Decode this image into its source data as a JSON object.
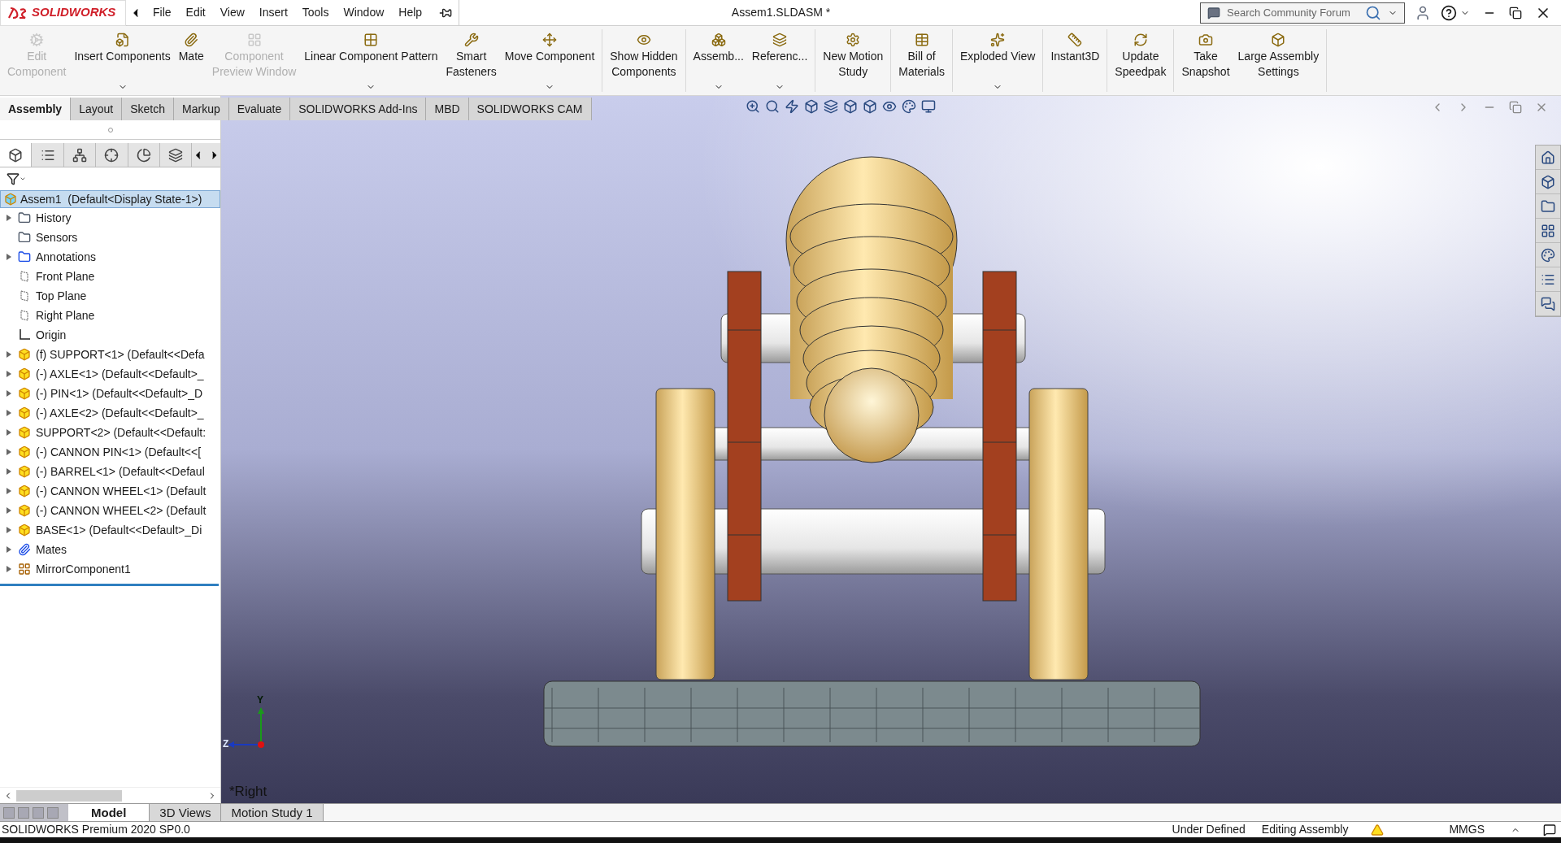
{
  "logo": {
    "text": "SOLIDWORKS"
  },
  "menu": [
    {
      "label": "File"
    },
    {
      "label": "Edit"
    },
    {
      "label": "View"
    },
    {
      "label": "Insert"
    },
    {
      "label": "Tools"
    },
    {
      "label": "Window"
    },
    {
      "label": "Help"
    }
  ],
  "window": {
    "title": "Assem1.SLDASM *"
  },
  "search": {
    "placeholder": "Search Community Forum"
  },
  "ribbon": [
    {
      "buttons": [
        {
          "lines": [
            "Edit",
            "Component"
          ],
          "disabled": true,
          "dropdown": false
        },
        {
          "lines": [
            "Insert Components"
          ],
          "disabled": false,
          "dropdown": true
        },
        {
          "lines": [
            "Mate"
          ],
          "disabled": false,
          "dropdown": false
        },
        {
          "lines": [
            "Component",
            "Preview Window"
          ],
          "disabled": true,
          "dropdown": false
        },
        {
          "lines": [
            "Linear Component Pattern"
          ],
          "disabled": false,
          "dropdown": true
        },
        {
          "lines": [
            "Smart",
            "Fasteners"
          ],
          "disabled": false,
          "dropdown": false
        },
        {
          "lines": [
            "Move Component"
          ],
          "disabled": false,
          "dropdown": true
        }
      ]
    },
    {
      "buttons": [
        {
          "lines": [
            "Show Hidden",
            "Components"
          ],
          "disabled": false,
          "dropdown": false
        }
      ]
    },
    {
      "buttons": [
        {
          "lines": [
            "Assemb..."
          ],
          "disabled": false,
          "dropdown": true
        },
        {
          "lines": [
            "Referenc..."
          ],
          "disabled": false,
          "dropdown": true
        }
      ]
    },
    {
      "buttons": [
        {
          "lines": [
            "New Motion",
            "Study"
          ],
          "disabled": false,
          "dropdown": false
        }
      ]
    },
    {
      "buttons": [
        {
          "lines": [
            "Bill of",
            "Materials"
          ],
          "disabled": false,
          "dropdown": false
        }
      ]
    },
    {
      "buttons": [
        {
          "lines": [
            "Exploded View"
          ],
          "disabled": false,
          "dropdown": true
        }
      ]
    },
    {
      "buttons": [
        {
          "lines": [
            "Instant3D"
          ],
          "disabled": false,
          "dropdown": false
        }
      ]
    },
    {
      "buttons": [
        {
          "lines": [
            "Update",
            "Speedpak"
          ],
          "disabled": false,
          "dropdown": false
        }
      ]
    },
    {
      "buttons": [
        {
          "lines": [
            "Take",
            "Snapshot"
          ],
          "disabled": false,
          "dropdown": false
        },
        {
          "lines": [
            "Large Assembly",
            "Settings"
          ],
          "disabled": false,
          "dropdown": false
        }
      ]
    }
  ],
  "tabs": [
    {
      "label": "Assembly",
      "selected": true
    },
    {
      "label": "Layout",
      "selected": false
    },
    {
      "label": "Sketch",
      "selected": false
    },
    {
      "label": "Markup",
      "selected": false
    },
    {
      "label": "Evaluate",
      "selected": false
    },
    {
      "label": "SOLIDWORKS Add-Ins",
      "selected": false
    },
    {
      "label": "MBD",
      "selected": false
    },
    {
      "label": "SOLIDWORKS CAM",
      "selected": false
    }
  ],
  "panel_tabs": [
    {
      "selected": true
    },
    {
      "selected": false
    },
    {
      "selected": false
    },
    {
      "selected": false
    },
    {
      "selected": false
    },
    {
      "selected": false
    }
  ],
  "tree": {
    "root": {
      "label": "Assem1  (Default<Display State-1>)",
      "selected": true
    },
    "children": [
      {
        "kind": "folder",
        "label": "History",
        "expandable": true
      },
      {
        "kind": "sensor",
        "label": "Sensors",
        "expandable": false
      },
      {
        "kind": "annotation",
        "label": "Annotations",
        "expandable": true
      },
      {
        "kind": "plane",
        "label": "Front Plane",
        "expandable": false
      },
      {
        "kind": "plane",
        "label": "Top Plane",
        "expandable": false
      },
      {
        "kind": "plane",
        "label": "Right Plane",
        "expandable": false
      },
      {
        "kind": "origin",
        "label": "Origin",
        "expandable": false
      },
      {
        "kind": "part",
        "label": "(f) SUPPORT<1> (Default<<Defa",
        "expandable": true
      },
      {
        "kind": "part",
        "label": "(-) AXLE<1> (Default<<Default>_",
        "expandable": true
      },
      {
        "kind": "part",
        "label": "(-) PIN<1> (Default<<Default>_D",
        "expandable": true
      },
      {
        "kind": "part",
        "label": "(-) AXLE<2> (Default<<Default>_",
        "expandable": true
      },
      {
        "kind": "part",
        "label": "SUPPORT<2> (Default<<Default:",
        "expandable": true
      },
      {
        "kind": "part",
        "label": "(-) CANNON PIN<1> (Default<<[",
        "expandable": true
      },
      {
        "kind": "part",
        "label": "(-) BARREL<1> (Default<<Defaul",
        "expandable": true
      },
      {
        "kind": "part",
        "label": "(-) CANNON WHEEL<1> (Default",
        "expandable": true
      },
      {
        "kind": "part",
        "label": "(-) CANNON WHEEL<2> (Default",
        "expandable": true
      },
      {
        "kind": "part",
        "label": "BASE<1> (Default<<Default>_Di",
        "expandable": true
      },
      {
        "kind": "mates",
        "label": "Mates",
        "expandable": true
      },
      {
        "kind": "mirror",
        "label": "MirrorComponent1",
        "expandable": true
      }
    ]
  },
  "viewport": {
    "view_name": "*Right",
    "triad": {
      "y": "Y",
      "z": "Z"
    }
  },
  "bottom_tabs": [
    {
      "label": "Model",
      "selected": true
    },
    {
      "label": "3D Views",
      "selected": false
    },
    {
      "label": "Motion Study 1",
      "selected": false
    }
  ],
  "status_bar": {
    "product": "SOLIDWORKS Premium 2020 SP0.0",
    "state": "Under Defined",
    "mode": "Editing Assembly",
    "units": "MMGS"
  }
}
